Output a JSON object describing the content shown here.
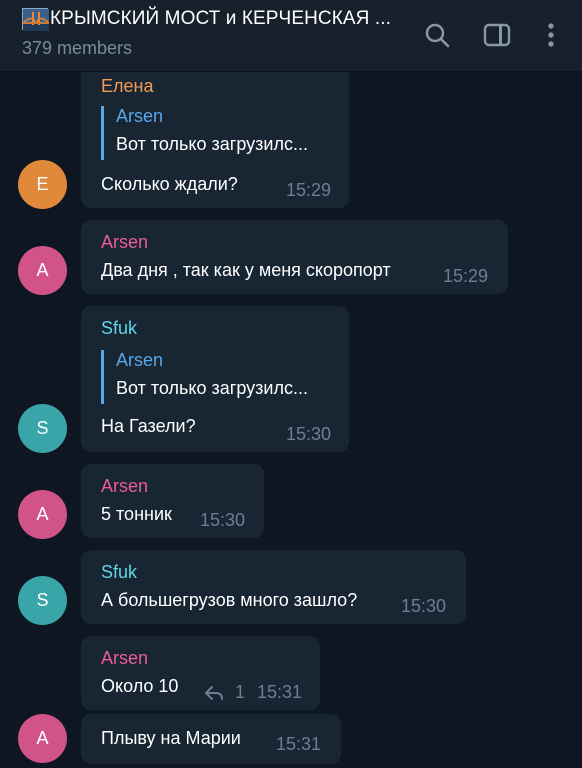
{
  "header": {
    "title": "КРЫМСКИЙ МОСТ и КЕРЧЕНСКАЯ ...",
    "members": "379 members",
    "icons": [
      "bridge-emoji",
      "search-icon",
      "side-panel-icon",
      "more-vert-icon"
    ]
  },
  "colors": {
    "background": "#0e1621",
    "header": "#17212b",
    "bubble": "#182533",
    "elena": "#f29b51",
    "arsen": "#ee5c91",
    "sfuk": "#5fd6e6",
    "reply_accent": "#5aa7e8",
    "avatar_e": "#e0893a",
    "avatar_a": "#d1538a",
    "avatar_s": "#3aa5a8"
  },
  "messages": [
    {
      "sender": "Елена",
      "reply_to": {
        "name": "Arsen",
        "text": "Вот только загрузилс..."
      },
      "text": "Сколько ждали?",
      "time": "15:29",
      "avatar": "Е"
    },
    {
      "sender": "Arsen",
      "text": "Два дня , так как у меня скоропорт",
      "time": "15:29",
      "avatar": "A"
    },
    {
      "sender": "Sfuk",
      "reply_to": {
        "name": "Arsen",
        "text": "Вот только загрузилс..."
      },
      "text": "На Газели?",
      "time": "15:30",
      "avatar": "S"
    },
    {
      "sender": "Arsen",
      "text": "5 тонник",
      "time": "15:30",
      "avatar": "A"
    },
    {
      "sender": "Sfuk",
      "text": "А большегрузов много зашло?",
      "time": "15:30",
      "avatar": "S"
    },
    {
      "sender": "Arsen",
      "text": "Около 10",
      "time": "15:31",
      "replies": "1"
    },
    {
      "text": "Плыву на Марии",
      "time": "15:31",
      "avatar": "A"
    }
  ]
}
